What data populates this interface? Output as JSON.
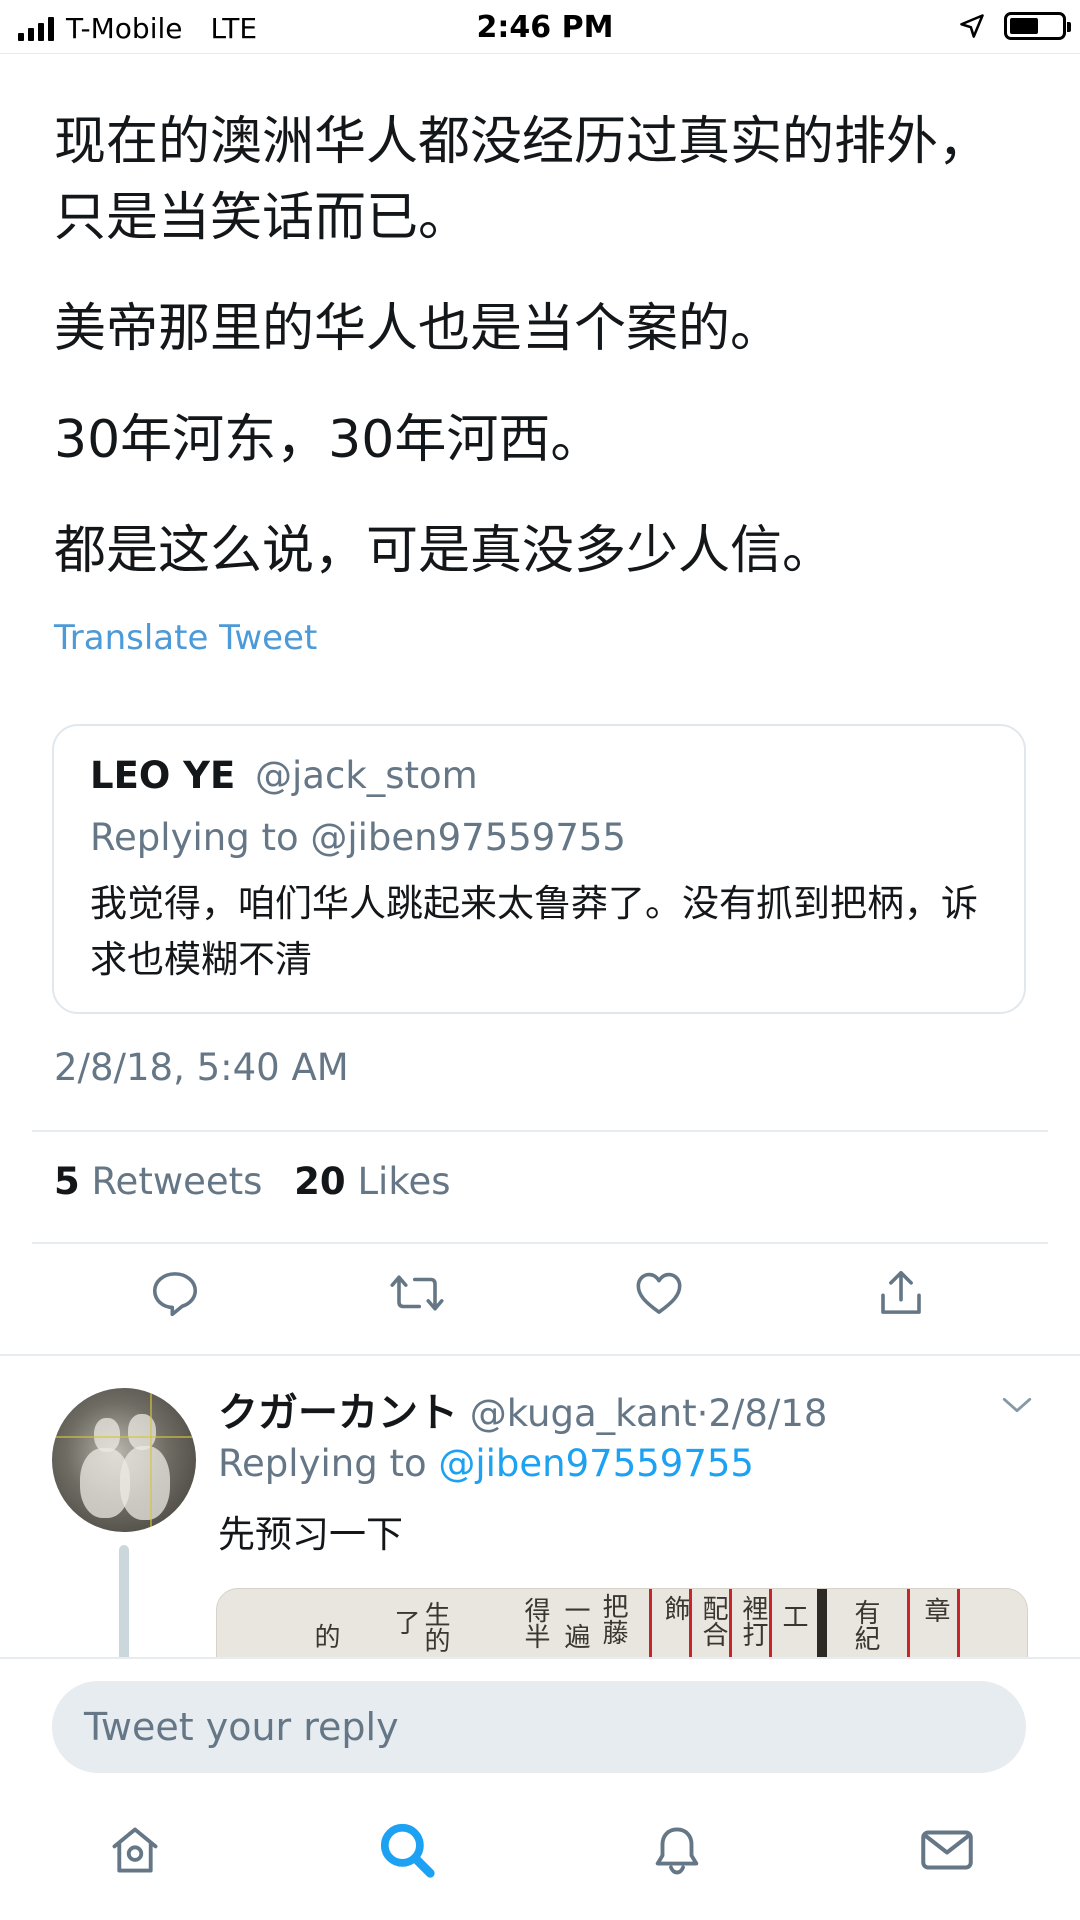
{
  "status_bar": {
    "carrier": "T-Mobile",
    "network": "LTE",
    "time": "2:46 PM",
    "battery_level": 0.55,
    "icons": [
      "signal-icon",
      "location-arrow-icon",
      "battery-icon"
    ]
  },
  "tweet": {
    "lines": [
      "现在的澳洲华人都没经历过真实的排外，只是当笑话而已。",
      "美帝那里的华人也是当个案的。",
      "30年河东，30年河西。",
      "都是这么说，可是真没多少人信。"
    ],
    "translate_label": "Translate Tweet",
    "timestamp": "2/8/18, 5:40 AM",
    "retweets_count": "5",
    "retweets_label": "Retweets",
    "likes_count": "20",
    "likes_label": "Likes"
  },
  "quote": {
    "name": "LEO YE",
    "handle": "@jack_stom",
    "replying": "Replying to @jiben97559755",
    "text": "我觉得，咱们华人跳起来太鲁莽了。没有抓到把柄，诉求也模糊不清"
  },
  "actions": [
    "reply-icon",
    "retweet-icon",
    "like-icon",
    "share-icon"
  ],
  "reply": {
    "name": "クガーカント",
    "handle": "@kuga_kant",
    "separator": "·",
    "date": "2/8/18",
    "replying_prefix": "Replying to",
    "replying_mention": "@jiben97559755",
    "text": "先预习一下",
    "media_columns": [
      "的",
      "了",
      "生的",
      "得半",
      "一遍",
      "把藤",
      "飾",
      "配合",
      "裡打",
      "工",
      "有紀",
      "章"
    ]
  },
  "composer": {
    "placeholder": "Tweet your reply"
  },
  "tabs": [
    "home-icon",
    "search-icon",
    "notifications-icon",
    "messages-icon"
  ],
  "colors": {
    "link": "#4d9ad8",
    "twitter_blue": "#1da1f2",
    "secondary_text": "#657786",
    "icon_gray": "#657786",
    "divider": "#e6ecf0"
  }
}
